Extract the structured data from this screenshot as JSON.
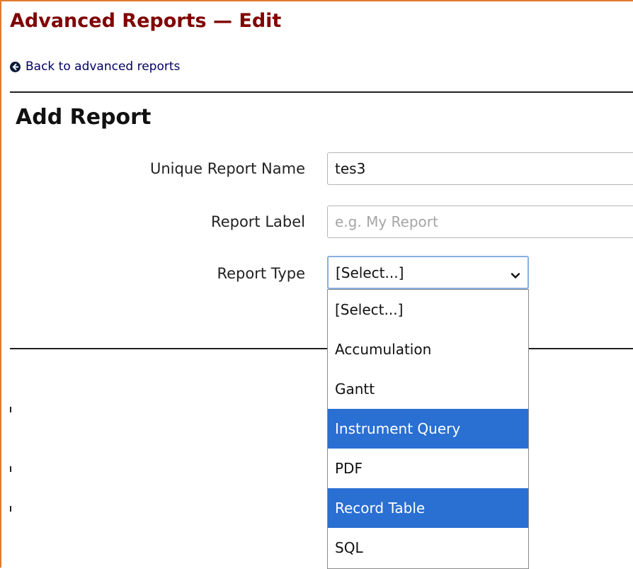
{
  "header": {
    "title": "Advanced Reports — Edit",
    "back_link": "Back to advanced reports"
  },
  "form": {
    "section_title": "Add Report",
    "unique_name": {
      "label": "Unique Report Name",
      "value": "tes3"
    },
    "report_label": {
      "label": "Report Label",
      "placeholder": "e.g. My Report"
    },
    "report_type": {
      "label": "Report Type",
      "selected": "[Select...]",
      "options": [
        "[Select...]",
        "Accumulation",
        "Gantt",
        "Instrument Query",
        "PDF",
        "Record Table",
        "SQL"
      ],
      "highlighted": [
        "Instrument Query",
        "Record Table"
      ]
    }
  },
  "colors": {
    "title": "#800000",
    "link": "#000066",
    "accent_border": "#e07b2c",
    "option_highlight": "#2a6fd2",
    "focus_border": "#88aee0"
  },
  "icons": {
    "back": "circle-arrow-left-icon",
    "select": "chevron-down-icon"
  }
}
